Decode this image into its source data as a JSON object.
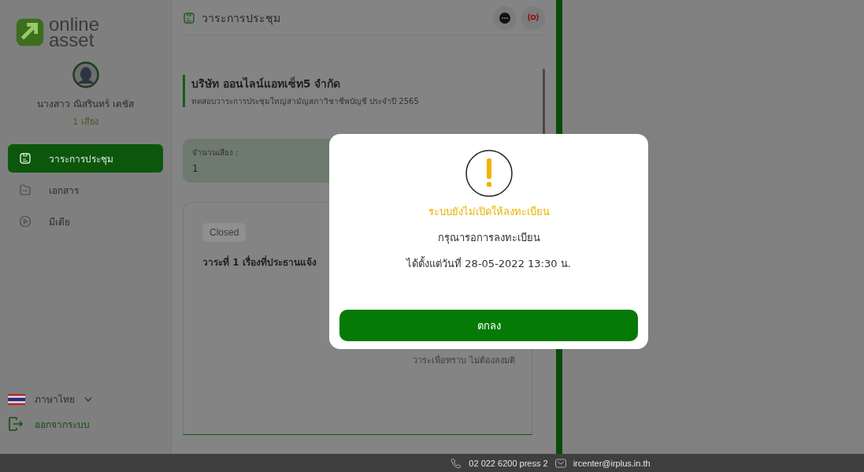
{
  "sidebar": {
    "logo": {
      "line1": "online",
      "line2": "asset"
    },
    "user": {
      "name": "นางสาว ณิสรินทร์ เตชัส",
      "votes": "1 เสียง"
    },
    "items": [
      {
        "kind": "agenda",
        "label": "วาระการประชุม",
        "selected": true
      },
      {
        "kind": "documents",
        "label": "เอกสาร",
        "selected": false
      },
      {
        "kind": "media",
        "label": "มีเดีย",
        "selected": false
      }
    ],
    "language": {
      "label": "ภาษาไทย"
    },
    "logout": {
      "label": "ออกจากระบบ"
    }
  },
  "main": {
    "title": "วาระการประชุม",
    "company": {
      "name": "บริษัท ออนไลน์แอทเซ็ท5 จำกัด",
      "subtitle": "ทดสอบวาระการประชุมใหญ่สามัญสภาวิชาชีพบัญชี ประจำปี 2565"
    },
    "votes": {
      "label": "จำนวนเสียง :",
      "value": "1"
    },
    "agenda": {
      "status": "Closed",
      "title": "วาระที่ 1 เรื่องที่ประธานแจ้ง",
      "note": "วาระเพื่อทราบ ไม่ต้องลงมติ"
    }
  },
  "modal": {
    "title": "ระบบยังไม่เปิดให้ลงทะเบียน",
    "message": "กรุณารอการลงทะเบียน",
    "date_line": "ได้ตั้งแต่วันที่ 28-05-2022 13:30 น.",
    "button": "ตกลง"
  },
  "footer": {
    "phone": "02 022 6200 press 2",
    "email": "ircenter@irplus.in.th"
  }
}
